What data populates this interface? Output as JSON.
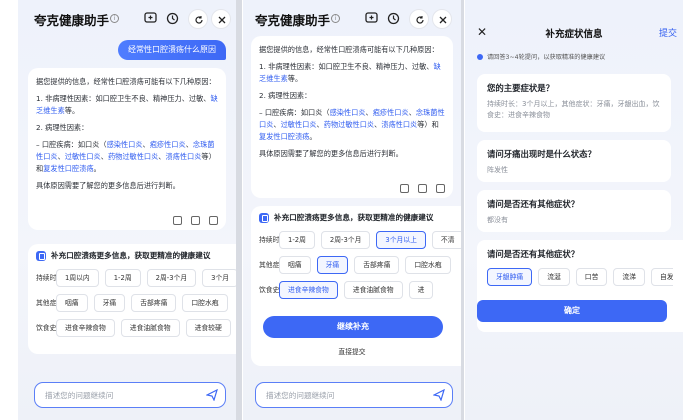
{
  "app_title": "夸克健康助手",
  "question": "经常性口腔溃疡什么原因",
  "answer": {
    "intro": "据您提供的信息，经常性口腔溃疡可能有以下几种原因：",
    "point1_prefix": "1. 非病理性因素：如口腔卫生不良、精神压力、过敏、",
    "point1_link": "缺乏维生素",
    "point1_suffix": "等。",
    "point2_title": "2. 病理性因素：",
    "point2_prefix": "– 口腔疾病：如口炎（",
    "links": [
      "感染性口炎",
      "疱疹性口炎",
      "念珠菌性口炎",
      "过敏性口炎",
      "药物过敏性口炎",
      "溃疡性口炎"
    ],
    "p1_tail": "等）和",
    "p1_link": "复发性口腔溃疡",
    "p1_end": "。",
    "p1_date": "具体原因需要了解您的更多信息后进行判断。"
  },
  "supplement": {
    "header": "补充口腔溃疡更多信息，获取更精准的健康建议",
    "duration_label": "持续时长",
    "duration_options_p1": [
      "1周以内",
      "1-2周",
      "2周-3个月",
      "3个月"
    ],
    "duration_options_p2": [
      "1-2周",
      "2周-3个月",
      "3个月以上",
      "不清"
    ],
    "other_symptoms_label": "其他症状",
    "other_symptoms_p1": [
      "咽痛",
      "牙痛",
      "舌部疼痛",
      "口腔水疱"
    ],
    "other_symptoms_p2": [
      "咽痛",
      "牙痛",
      "舌部疼痛",
      "口腔水疱"
    ],
    "diet_label": "饮食史",
    "diet_options_p1": [
      "进食辛辣食物",
      "进食油腻食物",
      "进食较硬"
    ],
    "diet_options_p2": [
      "进食辛辣食物",
      "进食油腻食物",
      "进"
    ],
    "continue_button": "继续补充",
    "direct_submit": "直接提交"
  },
  "input": {
    "placeholder": "描述您的问题继续问"
  },
  "panel3": {
    "title": "补充症状信息",
    "close": "✕",
    "submit": "提交",
    "note": "请回答3~4轮提问，以获取精准的健康建议",
    "q1_title": "您的主要症状是？",
    "q1_answer": "持续时长：3个月以上，其他症状：牙痛，牙龈出血，饮食史：进食辛辣食物",
    "q2_title": "请问牙痛出现时是什么状态？",
    "q2_answer": "阵发性",
    "q3_title": "请问是否还有其他症状？",
    "q3_answer": "都没有",
    "q4_title": "请问是否还有其他症状？",
    "q4_options": [
      "牙龈肿痛",
      "流涎",
      "口苦",
      "流涕",
      "自发"
    ],
    "confirm": "确定"
  },
  "colors": {
    "accent": "#3d68f5",
    "link": "#2f5cf0"
  }
}
